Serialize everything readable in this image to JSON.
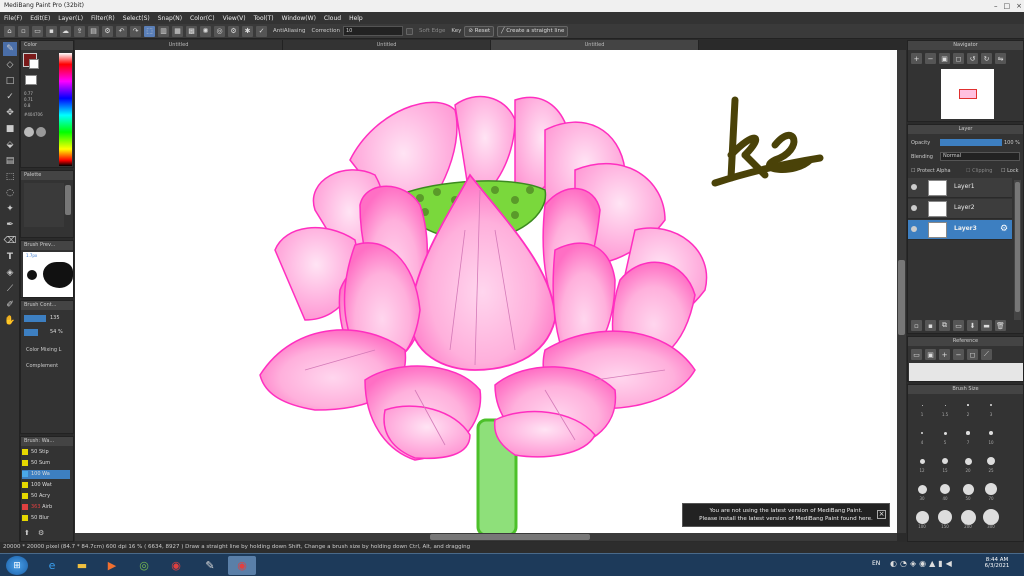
{
  "window": {
    "title": "MediBang Paint Pro (32bit)"
  },
  "menu": [
    "File(F)",
    "Edit(E)",
    "Layer(L)",
    "Filter(R)",
    "Select(S)",
    "Snap(N)",
    "Color(C)",
    "View(V)",
    "Tool(T)",
    "Window(W)",
    "Cloud",
    "Help"
  ],
  "toolbar": {
    "antialiasing_label": "AntiAliasing",
    "correction_label": "Correction",
    "correction_value": "10",
    "soft_edge_label": "Soft Edge",
    "key_label": "Key",
    "reset_label": "Reset",
    "straight_line_label": "Create a straight line"
  },
  "tabs": [
    "Untitled",
    "Untitled",
    "Untitled"
  ],
  "color_panel": {
    "title": "Color",
    "readout_1": "0.77",
    "readout_2": "0.71",
    "readout_3": "0.8",
    "hex": "#404706"
  },
  "palette_panel": {
    "title": "Palette"
  },
  "brush_preview_panel": {
    "title": "Brush Prev...",
    "size": "1.7px"
  },
  "brush_control_panel": {
    "title": "Brush Cont...",
    "size_value": "135",
    "opacity_value": "54 %",
    "color_mixing": "Color Mixing L",
    "complement": "Complement"
  },
  "brush_list_panel": {
    "title": "Brush: Wa...",
    "items": [
      {
        "size": "50",
        "name": "Stip",
        "color": "#e6d800"
      },
      {
        "size": "50",
        "name": "Sum",
        "color": "#e6d800"
      },
      {
        "size": "100",
        "name": "Wa",
        "color": "#4aa8e8"
      },
      {
        "size": "100",
        "name": "Wat",
        "color": "#e6d800"
      },
      {
        "size": "50",
        "name": "Acry",
        "color": "#e6d800"
      },
      {
        "size": "363",
        "name": "Airb",
        "color": "#e04040"
      },
      {
        "size": "50",
        "name": "Blur",
        "color": "#e6d800"
      }
    ]
  },
  "navigator_panel": {
    "title": "Navigator"
  },
  "layer_panel": {
    "title": "Layer",
    "opacity_label": "Opacity",
    "opacity_value": "100 %",
    "blending_label": "Blending",
    "blending_value": "Normal",
    "protect_alpha": "Protect Alpha",
    "clipping": "Clipping",
    "lock": "Lock",
    "layers": [
      {
        "name": "Layer1",
        "selected": false
      },
      {
        "name": "Layer2",
        "selected": false
      },
      {
        "name": "Layer3",
        "selected": true
      }
    ]
  },
  "reference_panel": {
    "title": "Reference"
  },
  "brush_size_panel": {
    "title": "Brush Size",
    "sizes": [
      "1",
      "1.5",
      "2",
      "3",
      "4",
      "5",
      "7",
      "10",
      "12",
      "15",
      "20",
      "25",
      "30",
      "40",
      "50",
      "70",
      "100",
      "150",
      "200",
      "300"
    ]
  },
  "canvas": {
    "signature_text": "ko"
  },
  "notification": {
    "line1": "You are not using the latest version of MediBang Paint.",
    "line2": "Please install the latest version of MediBang Paint found here."
  },
  "status": {
    "text": "20000 * 20000 pixel  (84.7 * 84.7cm)  600 dpi  16 %  ( 6634, 8927 )  Draw a straight line by holding down Shift, Change a brush size by holding down Ctrl, Alt, and dragging"
  },
  "taskbar": {
    "lang": "EN",
    "time": "8:44 AM",
    "date": "6/3/2021"
  },
  "colors": {
    "selected_layer": "#3d7fc1",
    "petal_stroke": "#ff2fc0",
    "stem": "#4cc02a",
    "signature": "#4a4208"
  }
}
